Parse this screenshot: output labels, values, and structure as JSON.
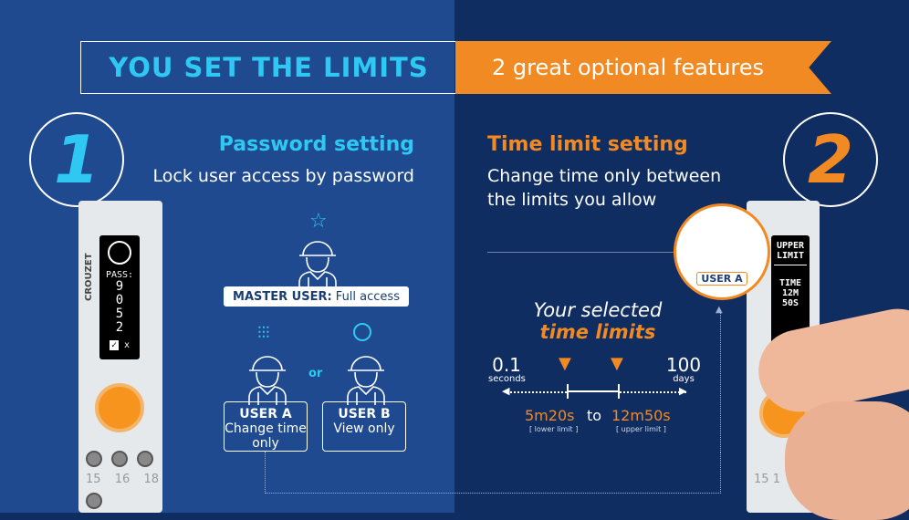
{
  "banner": {
    "left_title": "YOU SET THE LIMITS",
    "right_title": "2 great optional features"
  },
  "feature1": {
    "number": "1",
    "title": "Password setting",
    "subtitle": "Lock user access by password"
  },
  "feature2": {
    "number": "2",
    "title": "Time limit setting",
    "subtitle_line1": "Change time only between",
    "subtitle_line2": "the limits you allow"
  },
  "device_left": {
    "brand": "CROUZET",
    "screen_label": "PASS:",
    "digits": [
      "9",
      "0",
      "5",
      "2"
    ],
    "check": "✓",
    "cross": "x",
    "terminals": [
      "15",
      "16",
      "18"
    ]
  },
  "device_right": {
    "screen_title_1": "UPPER",
    "screen_title_2": "LIMIT",
    "line1": "TIME",
    "line2": "12M",
    "line3": "50S",
    "terminals": [
      "15",
      "1"
    ]
  },
  "users": {
    "master_bold": "MASTER USER:",
    "master_rest": " Full access",
    "or": "or",
    "user_a_title": "USER A",
    "user_a_desc_1": "Change time",
    "user_a_desc_2": "only",
    "user_b_title": "USER B",
    "user_b_desc": "View only",
    "user_a_badge": "USER A"
  },
  "time_limits": {
    "heading_1": "Your selected",
    "heading_2": "time limits",
    "min_value": "0.1",
    "min_unit": "seconds",
    "max_value": "100",
    "max_unit": "days",
    "lower": "5m20s",
    "lower_label": "[ lower limit ]",
    "to": "to",
    "upper": "12m50s",
    "upper_label": "[ upper limit ]"
  },
  "colors": {
    "left_bg": "#1f4a8f",
    "right_bg": "#0f2d60",
    "accent_cyan": "#2ec8f2",
    "accent_orange": "#f18a23"
  }
}
